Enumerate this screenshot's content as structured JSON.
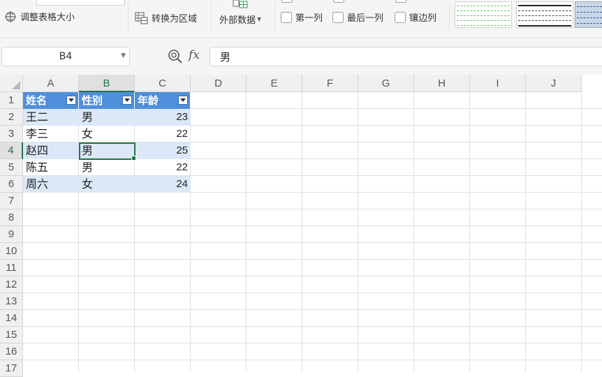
{
  "ribbon": {
    "resize_table": "调整表格大小",
    "convert_to_range": "转换为区域",
    "external_data": "外部数据",
    "first_column": "第一列",
    "last_column": "最后一列",
    "banded_columns": "镶边列"
  },
  "formula_bar": {
    "name_box": "B4",
    "fx_label": "fx",
    "formula_value": "男"
  },
  "grid": {
    "columns": [
      "A",
      "B",
      "C",
      "D",
      "E",
      "F",
      "G",
      "H",
      "I",
      "J"
    ],
    "rows": [
      "1",
      "2",
      "3",
      "4",
      "5",
      "6",
      "7",
      "8",
      "9",
      "10",
      "11",
      "12",
      "13",
      "14",
      "15",
      "16",
      "17"
    ],
    "active_column": "B",
    "active_row": "4",
    "table": {
      "headers": [
        "姓名",
        "性别",
        "年龄"
      ],
      "rows": [
        [
          "王二",
          "男",
          "23"
        ],
        [
          "李三",
          "女",
          "22"
        ],
        [
          "赵四",
          "男",
          "25"
        ],
        [
          "陈五",
          "男",
          "22"
        ],
        [
          "周六",
          "女",
          "24"
        ]
      ]
    }
  },
  "colors": {
    "table_header": "#4f8fdb",
    "band": "#dbe8f7",
    "selection": "#217346"
  }
}
